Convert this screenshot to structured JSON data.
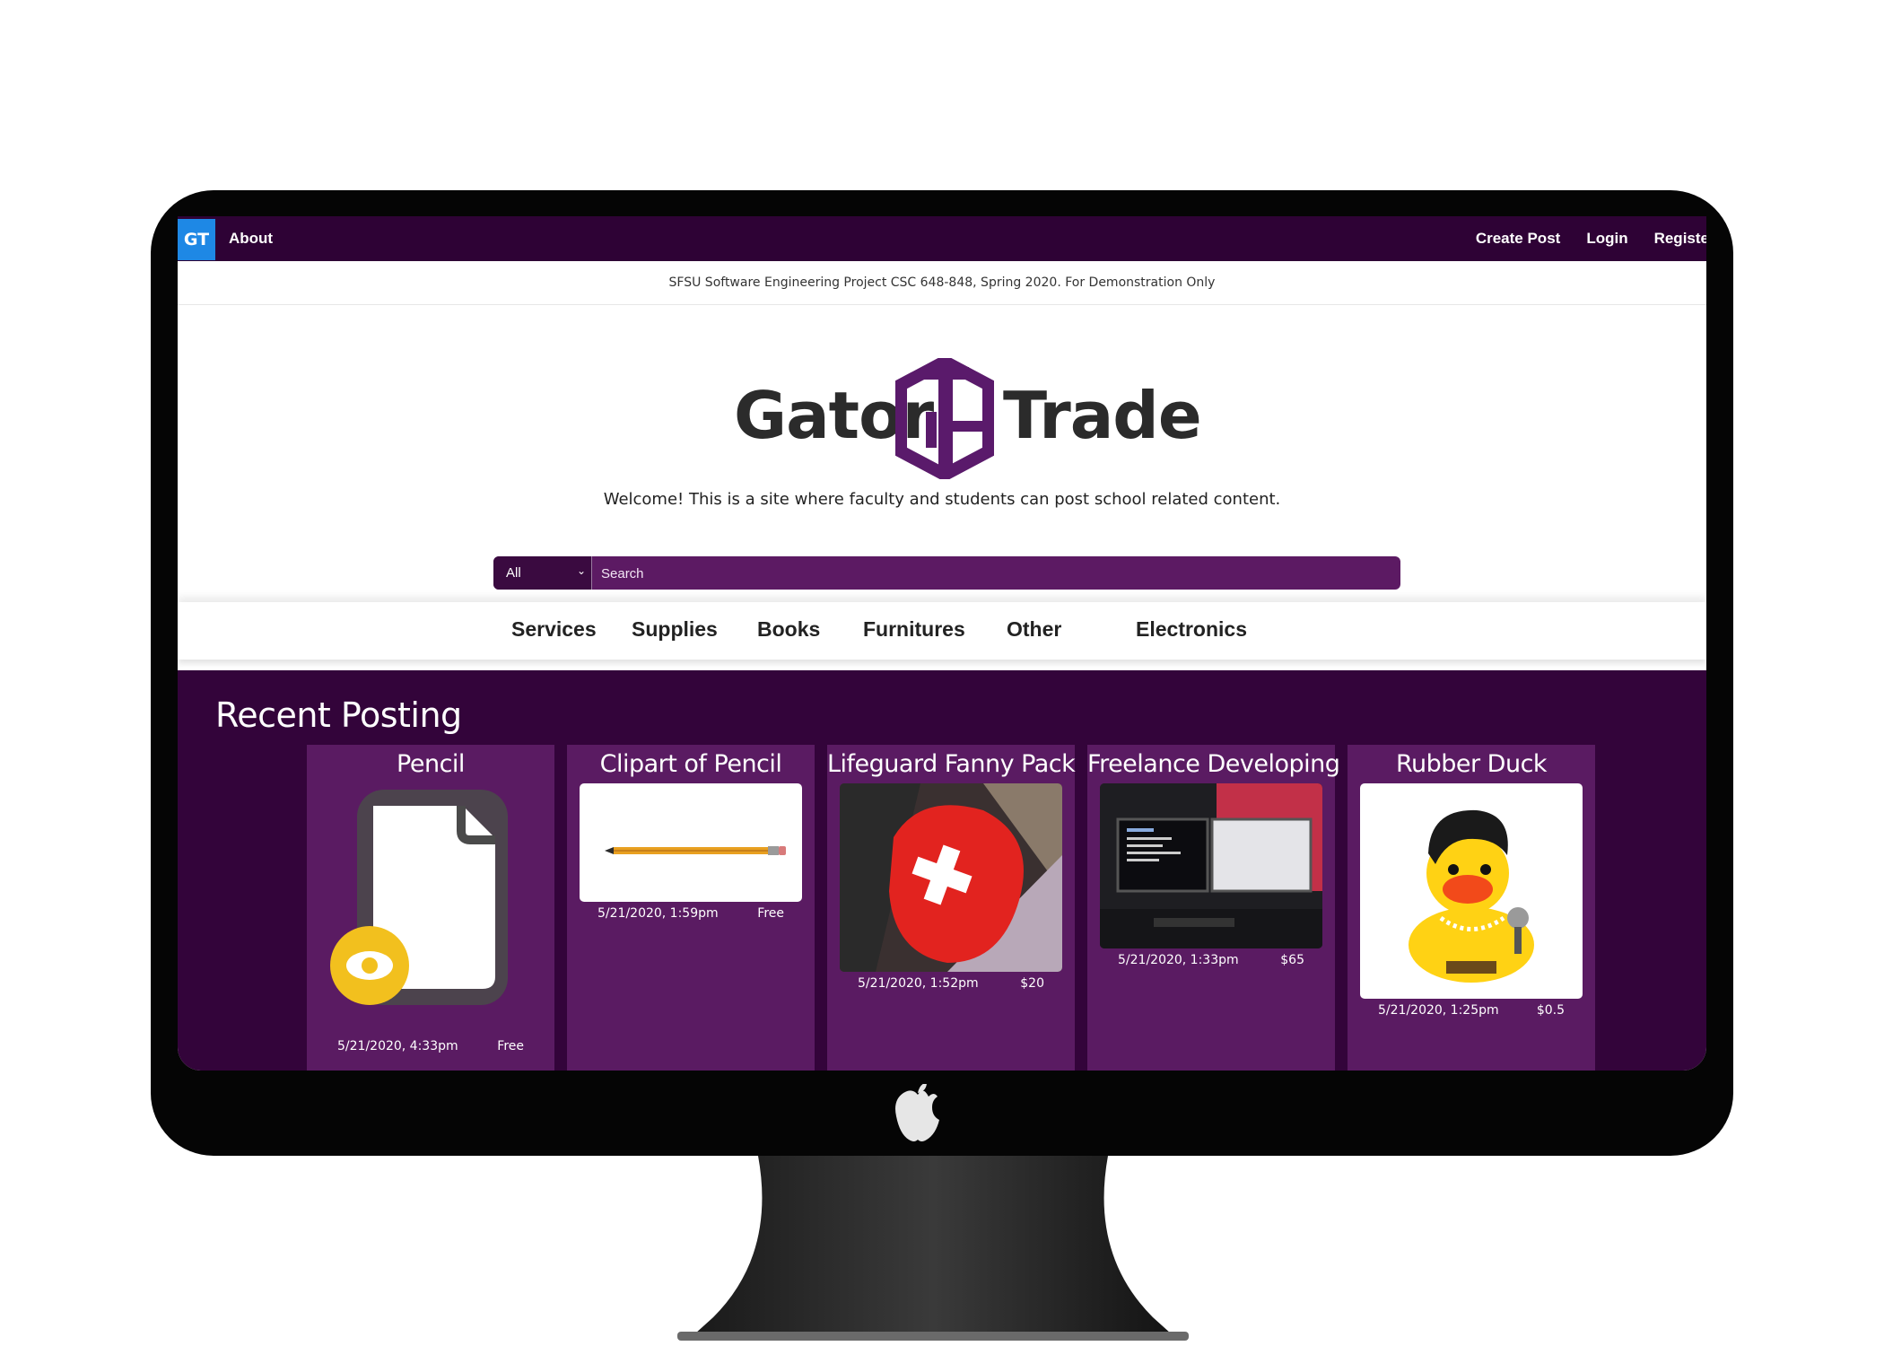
{
  "nav": {
    "brand_mark": "GT",
    "about": "About",
    "right_links": [
      "Create Post",
      "Login",
      "Registe"
    ]
  },
  "notice": "SFSU Software Engineering Project CSC 648-848, Spring 2020. For Demonstration Only",
  "logo": {
    "left_word": "Gator",
    "right_word": "Trade"
  },
  "welcome": "Welcome! This is a site where faculty and students can post school related content.",
  "search": {
    "category_selected": "All",
    "placeholder": "Search"
  },
  "categories": [
    "Services",
    "Supplies",
    "Books",
    "Furnitures",
    "Other",
    "Electronics"
  ],
  "recent": {
    "title": "Recent Posting",
    "posts": [
      {
        "title": "Pencil",
        "date": "5/21/2020, 4:33pm",
        "price": "Free",
        "image": "placeholder-file-icon"
      },
      {
        "title": "Clipart of Pencil",
        "date": "5/21/2020, 1:59pm",
        "price": "Free",
        "image": "pencil-clipart"
      },
      {
        "title": "Lifeguard Fanny Pack",
        "date": "5/21/2020, 1:52pm",
        "price": "$20",
        "image": "red-fanny-pack-photo"
      },
      {
        "title": "Freelance Developing",
        "date": "5/21/2020, 1:33pm",
        "price": "$65",
        "image": "developer-desk-photo"
      },
      {
        "title": "Rubber Duck",
        "date": "5/21/2020, 1:25pm",
        "price": "$0.5",
        "image": "rubber-duck-photo"
      }
    ]
  },
  "colors": {
    "nav_bg": "#2e0235",
    "brand_blue": "#1e88e5",
    "search_purple": "#5c1a63",
    "recent_bg": "#33043a",
    "card_bg": "#5a1b62",
    "logo_purple": "#5a1a6b"
  }
}
